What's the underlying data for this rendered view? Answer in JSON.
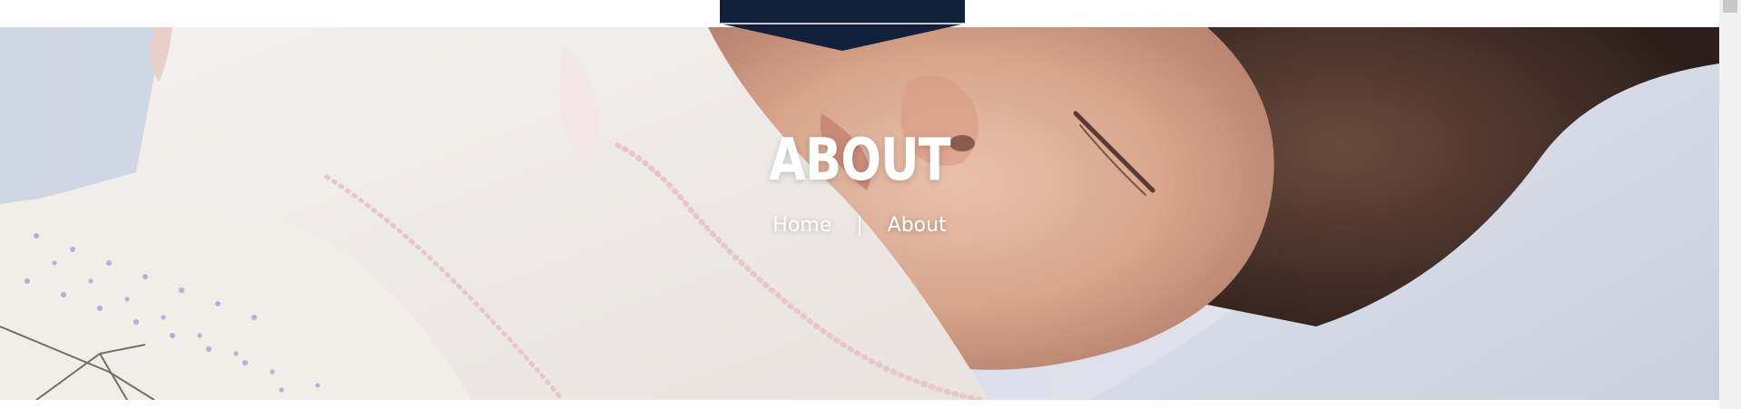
{
  "hero": {
    "title": "ABOUT",
    "image_icon": "sleeping-baby-photo"
  },
  "breadcrumb": {
    "home": "Home",
    "separator": "|",
    "current": "About"
  },
  "colors": {
    "badge": "#132039",
    "text": "#ffffff"
  }
}
